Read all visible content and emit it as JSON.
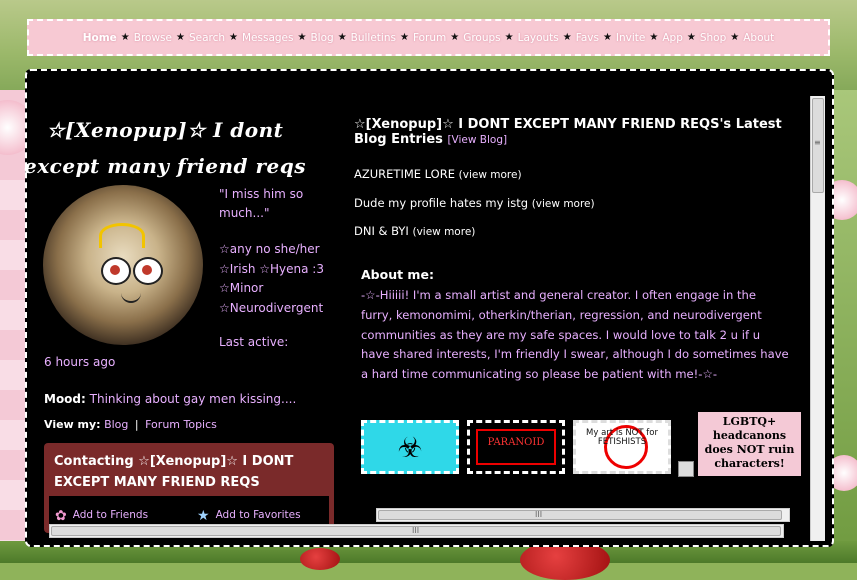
{
  "nav": {
    "items": [
      "Home",
      "Browse",
      "Search",
      "Messages",
      "Blog",
      "Bulletins",
      "Forum",
      "Groups",
      "Layouts",
      "Favs",
      "Invite",
      "App",
      "Shop",
      "About"
    ],
    "separator": "★"
  },
  "profile": {
    "name": "☆[Xenopup]☆ I dont except many friend reqs",
    "quote": "\"I miss him so much...\"",
    "info_lines": [
      "☆any no she/her",
      "☆Irish ☆Hyena :3",
      "☆Minor",
      "☆Neurodivergent"
    ],
    "last_active_label": "Last active:",
    "last_active_value": "6 hours ago",
    "mood_label": "Mood:",
    "mood_value": "Thinking about gay men kissing....",
    "view_my_label": "View my:",
    "view_my_blog": "Blog",
    "view_my_sep": "|",
    "view_my_forum": "Forum Topics"
  },
  "contact": {
    "title": "Contacting ☆[Xenopup]☆ I DONT EXCEPT MANY FRIEND REQS",
    "add_friends": "Add to Friends",
    "add_favorites": "Add to Favorites",
    "icons": [
      "flower-icon",
      "star-icon"
    ]
  },
  "blog": {
    "title": "☆[Xenopup]☆ I DONT EXCEPT MANY FRIEND REQS's Latest Blog Entries",
    "view_blog": "[View Blog]",
    "entries": [
      {
        "title": "AZURETIME LORE",
        "link": "(view more)"
      },
      {
        "title": "Dude my profile hates my istg",
        "link": "(view more)"
      },
      {
        "title": "DNI & BYI",
        "link": "(view more)"
      }
    ]
  },
  "about": {
    "heading": "About me:",
    "body": "-☆-Hiiiii! I'm a small artist and general creator. I often engage in the furry, kemonomimi, otherkin/therian, regression, and neurodivergent communities as they are my safe spaces. I would love to talk 2 u if u have shared interests, I'm friendly I swear, although I do sometimes have a hard time communicating so please be patient with me!-☆-"
  },
  "stamps": {
    "biohazard": "☣",
    "paranoid": "PARANOID",
    "not_fetishists": "My art is NOT for FETISHISTS",
    "lgbtq": "LGBTQ+ headcanons does NOT ruin characters!"
  },
  "scroll": {
    "grip": "≡",
    "hgrip": "III"
  },
  "colors": {
    "nav_bg": "#f7c9d3",
    "panel_bg": "#000000",
    "accent_text": "#e8b0ff",
    "contact_bg": "#7a2a2a"
  }
}
